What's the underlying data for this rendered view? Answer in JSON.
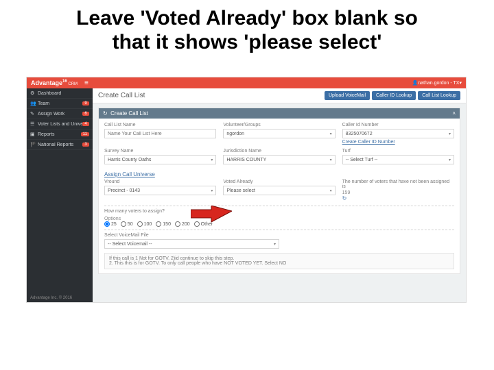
{
  "slide": {
    "title_line1": "Leave 'Voted Already' box blank so",
    "title_line2": "that it shows 'please select'"
  },
  "topbar": {
    "brand": "Advantage",
    "brand_suffix": "16",
    "brand_sub": " CRM",
    "user": "nathan.gordon - TX"
  },
  "sidebar": {
    "items": [
      {
        "icon": "⚙",
        "label": "Dashboard",
        "badge": ""
      },
      {
        "icon": "👥",
        "label": "Team",
        "badge": "9"
      },
      {
        "icon": "✎",
        "label": "Assign Work",
        "badge": "6"
      },
      {
        "icon": "☰",
        "label": "Voter Lists and Universes",
        "badge": "4"
      },
      {
        "icon": "▣",
        "label": "Reports",
        "badge": "11"
      },
      {
        "icon": "🏴",
        "label": "National Reports",
        "badge": "3"
      }
    ],
    "footer": "Advantage Inc. © 2016"
  },
  "header": {
    "title": "Create Call List",
    "buttons": [
      "Upload VoiceMail",
      "Caller ID Lookup",
      "Call List Lookup"
    ]
  },
  "panel": {
    "title": "Create Call List",
    "refresh_icon": "↻",
    "collapse_icon": "˄"
  },
  "form": {
    "call_list_name": {
      "label": "Call List Name",
      "placeholder": "Name Your Call List Here"
    },
    "volunteer_groups": {
      "label": "Volunteer/Groups",
      "value": "ngordon"
    },
    "caller_id_number": {
      "label": "Caller Id Number",
      "value": "8325070672",
      "link": "Create Caller ID Number"
    },
    "survey_name": {
      "label": "Survey Name",
      "value": "Harris County Oaths"
    },
    "jurisdiction_name": {
      "label": "Jurisdiction Name",
      "value": "HARRIS COUNTY"
    },
    "turf": {
      "label": "Turf",
      "value": "-- Select Turf --"
    },
    "assign_universe_link": "Assign Call Universe",
    "vround": {
      "label": "Vround",
      "value": "Precinct - 0143"
    },
    "voted_already": {
      "label": "Voted Already",
      "value": "Please select"
    },
    "unassigned_note": {
      "label": "The number of voters that have not been assigned is",
      "value": "159"
    },
    "how_many_label": "How many voters to assign?",
    "options_label": "Options",
    "radios": [
      "25",
      "50",
      "100",
      "150",
      "200",
      "Other"
    ],
    "voicemail": {
      "label": "Select VoiceMail File",
      "value": "-- Select Voicemail --"
    },
    "note1": "If this call is 1  Not for GOTV. 2)id continue to skip this step.",
    "note2": "2. This this is for GOTV. To only call people who have NOT VOTED YET. Select NO"
  }
}
